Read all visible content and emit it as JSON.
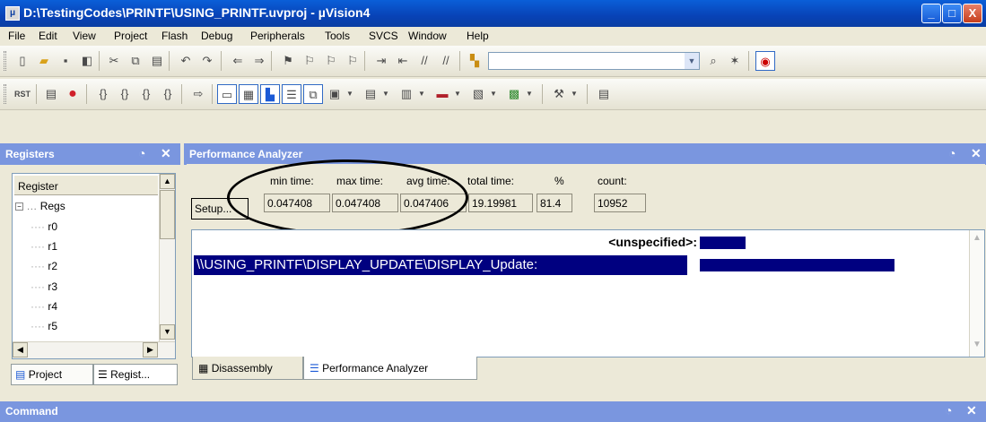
{
  "window": {
    "title": "D:\\TestingCodes\\PRINTF\\USING_PRINTF.uvproj - µVision4",
    "app_icon": "uv-icon",
    "minimize": "_",
    "maximize": "□",
    "close": "X"
  },
  "menu": [
    "File",
    "Edit",
    "View",
    "Project",
    "Flash",
    "Debug",
    "Peripherals",
    "Tools",
    "SVCS",
    "Window",
    "Help"
  ],
  "registers_panel": {
    "title": "Registers",
    "column_header": "Register",
    "tree_root": "Regs",
    "items": [
      "r0",
      "r1",
      "r2",
      "r3",
      "r4",
      "r5"
    ],
    "tabs": [
      "Project",
      "Regist..."
    ]
  },
  "perf_panel": {
    "title": "Performance Analyzer",
    "setup_label": "Setup...",
    "columns": {
      "min_label": "min time:",
      "max_label": "max time:",
      "avg_label": "avg time:",
      "total_label": "total time:",
      "pct_label": "%",
      "count_label": "count:"
    },
    "values": {
      "min": "0.047408",
      "max": "0.047408",
      "avg": "0.047406",
      "total": "19.19981",
      "pct": "81.4",
      "count": "10952"
    },
    "rows": [
      {
        "name": "<unspecified>:",
        "share": 0.19
      },
      {
        "name": "\\\\USING_PRINTF\\DISPLAY_UPDATE\\DISPLAY_Update:",
        "share": 0.814
      }
    ],
    "bottom_tabs": [
      "Disassembly",
      "Performance Analyzer"
    ]
  },
  "command_panel": {
    "title": "Command"
  },
  "colors": {
    "accent": "#000080",
    "panel_header": "#7a96df",
    "title_bar": "#0842b6"
  }
}
